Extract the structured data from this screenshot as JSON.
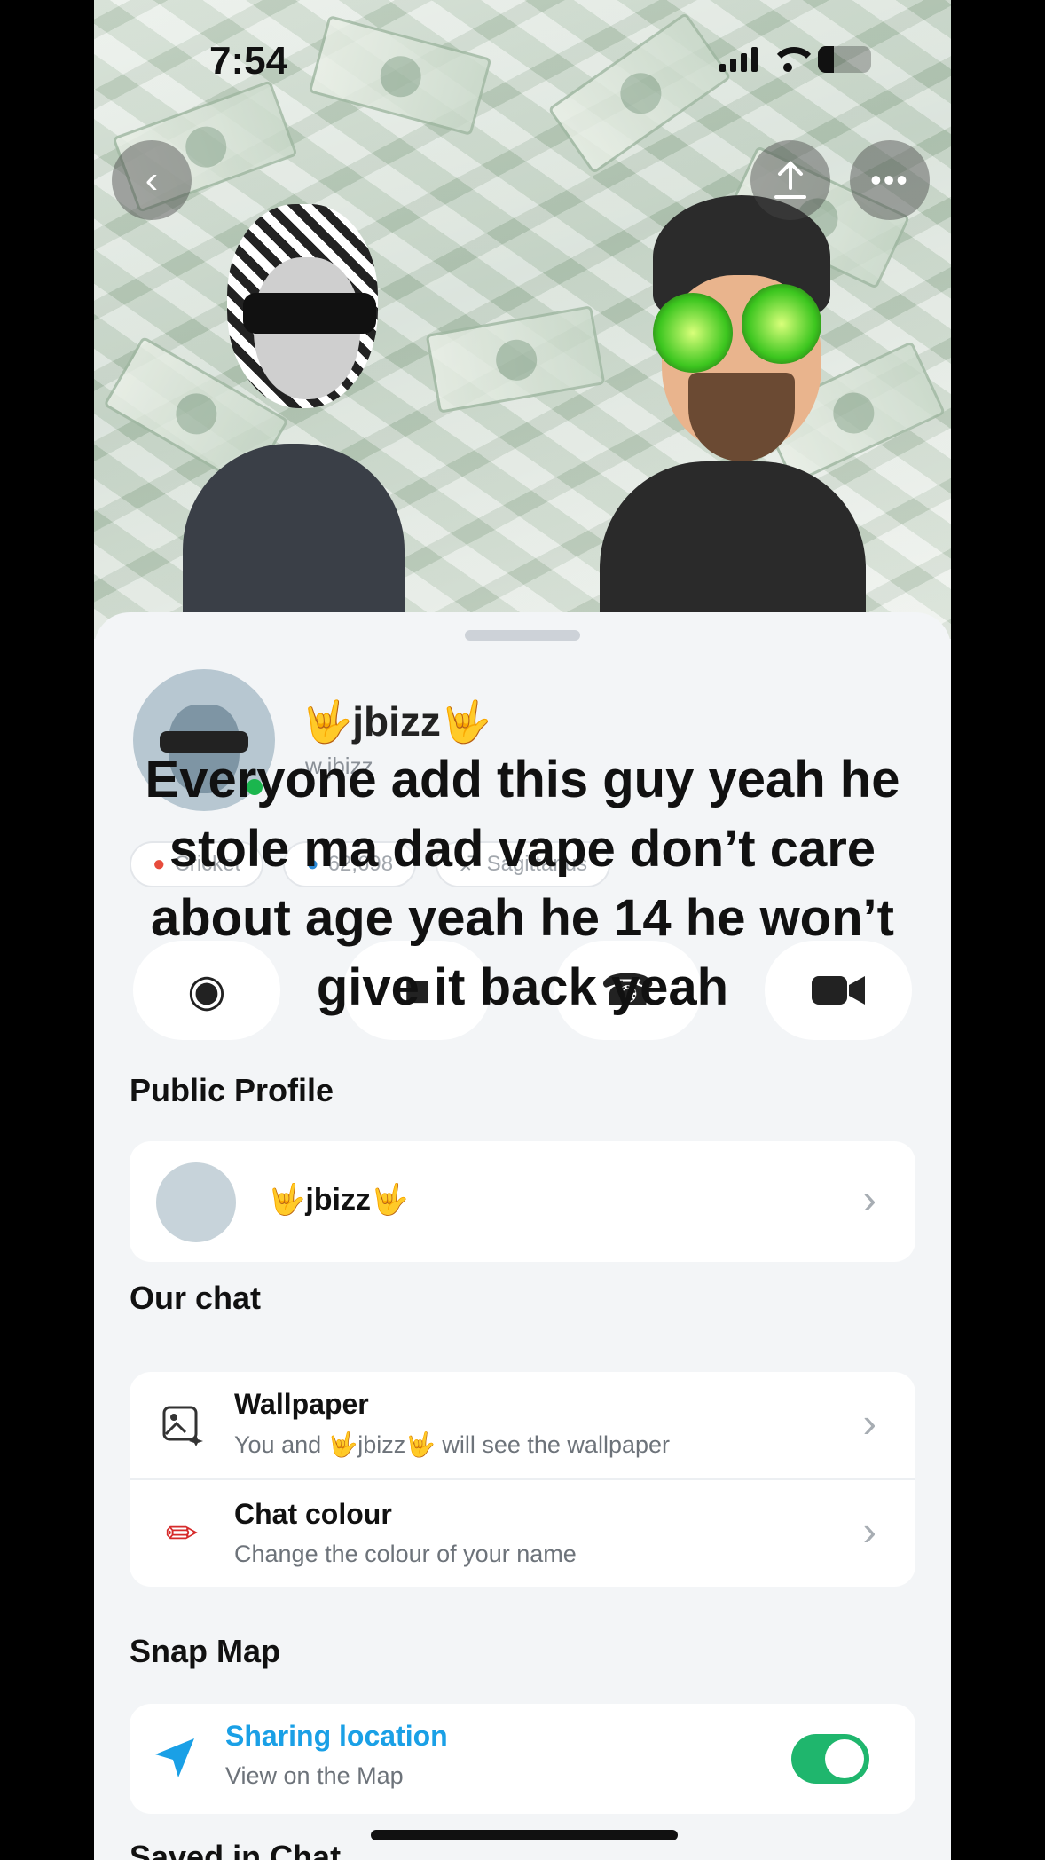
{
  "status_bar": {
    "time": "7:54"
  },
  "profile": {
    "display_name": "🤟jbizz🤟",
    "username": "w.jbizz",
    "chips": [
      "Cricket",
      "62,698",
      "Sagittarius"
    ]
  },
  "overlay_caption": "Everyone add this guy yeah he stole ma dad vape don’t care about age yeah he 14 he won’t give it back yeah",
  "public_profile": {
    "title": "Public Profile",
    "name": "🤟jbizz🤟"
  },
  "our_chat": {
    "title": "Our chat",
    "wallpaper_title": "Wallpaper",
    "wallpaper_sub": "You and 🤟jbizz🤟 will see the wallpaper",
    "colour_title": "Chat colour",
    "colour_sub": "Change the colour of your name"
  },
  "snap_map": {
    "title": "Snap Map",
    "sharing_title": "Sharing location",
    "sharing_sub": "View on the Map",
    "sharing_enabled": true
  },
  "saved_in_chat": {
    "title": "Saved in Chat"
  },
  "icons": {
    "back": "back-icon",
    "share": "share-icon",
    "more": "more-icon",
    "camera": "camera-icon",
    "chat": "chat-icon",
    "phone": "phone-icon",
    "video": "video-icon",
    "wallpaper": "wallpaper-icon",
    "crayon": "crayon-icon",
    "location": "location-arrow-icon"
  },
  "colors": {
    "accent": "#1aa0e6",
    "toggle_on": "#1fb66d"
  }
}
